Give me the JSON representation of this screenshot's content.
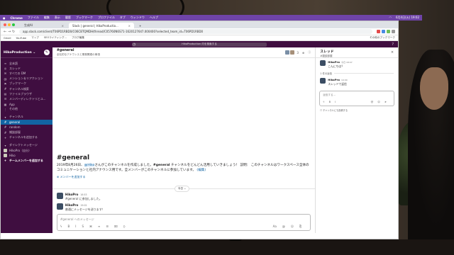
{
  "mac_menubar": {
    "app": "Chrome",
    "items": [
      "ファイル",
      "編集",
      "表示",
      "履歴",
      "ブックマーク",
      "プロファイル",
      "タブ",
      "ウィンドウ",
      "ヘルプ"
    ],
    "clock": "6月4日(火)  19:02"
  },
  "browser": {
    "tabs": [
      {
        "title": "生成AI",
        "active": false
      },
      {
        "title": "Slack | general | HikoProductio...",
        "active": true
      }
    ],
    "url": "app.slack.com/client/T06PD1RBD0/C06CBTQMDH/thread/C05760N6S71-1620127647.000400?selected_team_id=T06PD1RBD0",
    "bookmarks": [
      "Gmail",
      "YouTube",
      "マップ",
      "SEOライティング...",
      "ブログ編集",
      "その他のブックマーク"
    ]
  },
  "slack": {
    "search_placeholder": "HikoProduction 内を検索する",
    "workspace": "HikoProduction",
    "sidebar": {
      "items": [
        {
          "icon": "≡",
          "label": "全未読"
        },
        {
          "icon": "◎",
          "label": "スレッド"
        },
        {
          "icon": "✉",
          "label": "すべての DM"
        },
        {
          "icon": "@",
          "label": "メンション＆リアクション"
        },
        {
          "icon": "⚑",
          "label": "ブックマーク"
        },
        {
          "icon": "#",
          "label": "チャンネル検索"
        },
        {
          "icon": "▤",
          "label": "ファイルブラウザ"
        },
        {
          "icon": "☰",
          "label": "メンバーディレクトリとユ..."
        },
        {
          "icon": "▦",
          "label": "App"
        },
        {
          "icon": "⋮",
          "label": "その他"
        }
      ],
      "channels_header": "チャンネル",
      "channels": [
        {
          "label": "general",
          "selected": true
        },
        {
          "label": "random",
          "selected": false
        },
        {
          "label": "雑談部屋",
          "selected": false
        }
      ],
      "add_channel": "チャンネルを追加する",
      "dm_header": "ダイレクトメッセージ",
      "dms": [
        "HikoPro（自分）",
        "Hiko"
      ],
      "add_member": "チームメンバーを追加する"
    },
    "channel": {
      "name": "#general",
      "topic": "全社的なアナウンスと業務関連の事項",
      "member_count": "3"
    },
    "intro": {
      "title": "#general",
      "date_text": "2019年8月26日、",
      "mention": "@Hiko",
      "text_after_mention": "さんがこのチャンネルを作成しました。",
      "bold_channel": "#general",
      "text_body": " チャンネルをどんどん活用していきましょう！ 説明： このチャンネルはワークスペース全体のコミュニケーションと社内アナウンス用です。全メンバーがこのチャンネルに参加しています。",
      "edit_link": "(編集)",
      "add_member_link": "メンバーを追加する"
    },
    "divider_label": "今日 ⌄",
    "messages": [
      {
        "author": "HikoPro",
        "time": "16:53",
        "text": "#general に参加しました。"
      },
      {
        "author": "HikoPro",
        "time": "19:02",
        "text": "普通にメッセージを送ります！"
      }
    ],
    "composer_placeholder": "#general へのメッセージ",
    "composer_tools": [
      "ϟ",
      "B",
      "I",
      "S",
      "⌘",
      "≡",
      "☰",
      "⌧",
      "⟨⟩"
    ],
    "composer_right": [
      "Aa",
      "@",
      "☺",
      "⎘"
    ],
    "thread": {
      "title": "スレッド",
      "subtitle": "#雑談部屋",
      "root": {
        "author": "HikoPro",
        "time": "今日 18:47",
        "text": "こんにちは？"
      },
      "reply_count": "1 件の返信",
      "reply": {
        "author": "HikoPro",
        "time": "19:00",
        "text": "スレッドで返信"
      },
      "composer_placeholder": "返信する...",
      "also_send": "チャンネルにも投稿する"
    }
  }
}
